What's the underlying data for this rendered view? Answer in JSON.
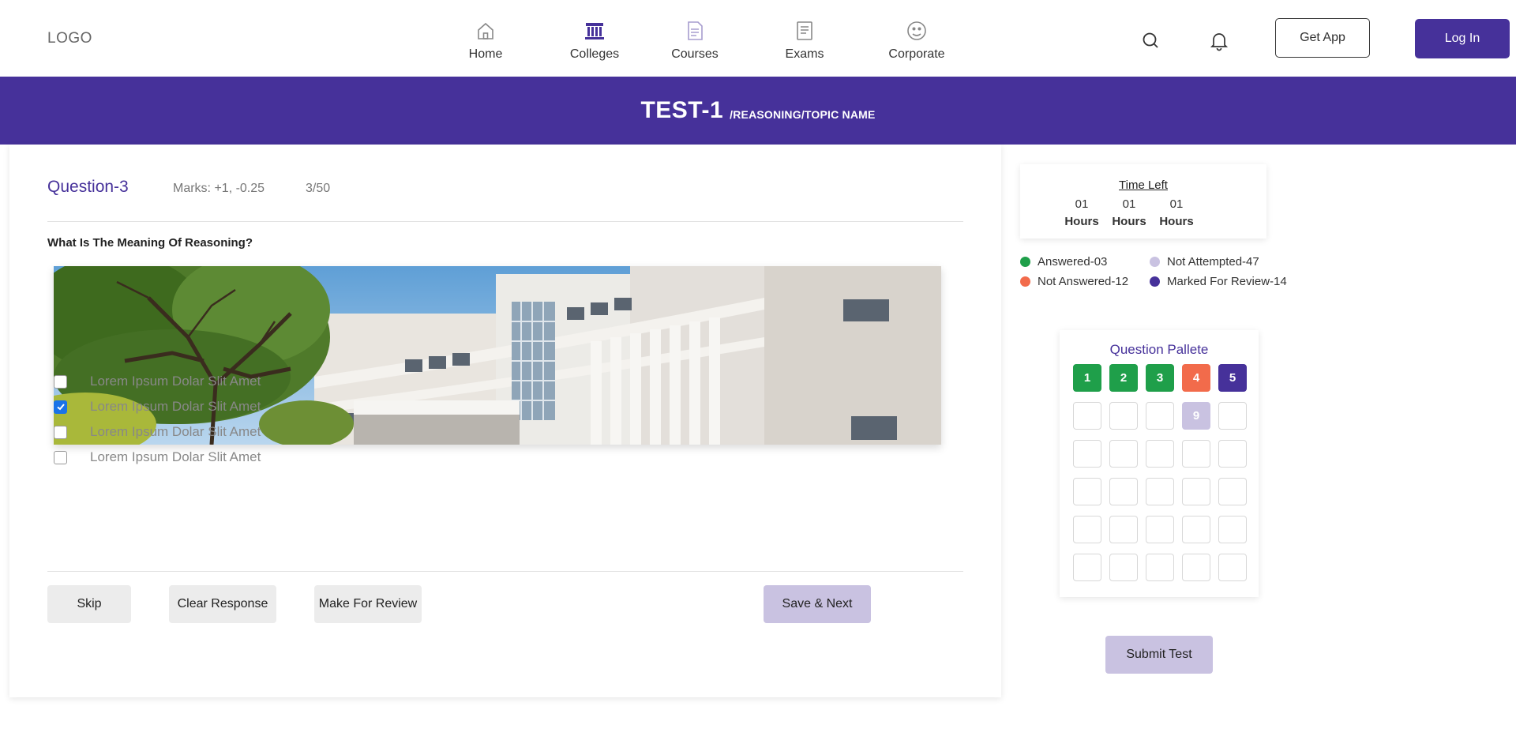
{
  "header": {
    "logo": "LOGO",
    "nav": [
      {
        "label": "Home",
        "icon": "home-icon"
      },
      {
        "label": "Colleges",
        "icon": "colleges-icon"
      },
      {
        "label": "Courses",
        "icon": "courses-icon"
      },
      {
        "label": "Exams",
        "icon": "exams-icon"
      },
      {
        "label": "Corporate",
        "icon": "corporate-icon"
      }
    ],
    "get_app": "Get App",
    "login": "Log In"
  },
  "banner": {
    "title": "TEST-1",
    "path": "/REASONING/TOPIC NAME"
  },
  "question": {
    "title": "Question-3",
    "marks": "Marks: +1, -0.25",
    "count": "3/50",
    "text": "What Is The Meaning Of Reasoning?",
    "options": [
      {
        "text": "Lorem Ipsum Dolar Slit Amet",
        "checked": false
      },
      {
        "text": "Lorem Ipsum Dolar Slit Amet",
        "checked": true
      },
      {
        "text": "Lorem Ipsum Dolar Slit Amet",
        "checked": false
      },
      {
        "text": "Lorem Ipsum Dolar Slit Amet",
        "checked": false
      }
    ],
    "actions": {
      "skip": "Skip",
      "clear": "Clear Response",
      "review": "Make For Review",
      "save": "Save & Next"
    }
  },
  "timer": {
    "label": "Time Left",
    "values": [
      {
        "num": "01",
        "unit": "Hours"
      },
      {
        "num": "01",
        "unit": "Hours"
      },
      {
        "num": "01",
        "unit": "Hours"
      }
    ]
  },
  "legend": {
    "answered": "Answered-03",
    "not_attempted": "Not Attempted-47",
    "not_answered": "Not Answered-12",
    "marked_review": "Marked For Review-14"
  },
  "palette": {
    "title": "Question Pallete",
    "cells": [
      {
        "label": "1",
        "status": "ans"
      },
      {
        "label": "2",
        "status": "ans"
      },
      {
        "label": "3",
        "status": "ans"
      },
      {
        "label": "4",
        "status": "nans"
      },
      {
        "label": "5",
        "status": "rev"
      },
      {
        "label": "",
        "status": "empty"
      },
      {
        "label": "",
        "status": "empty"
      },
      {
        "label": "",
        "status": "empty"
      },
      {
        "label": "9",
        "status": "na"
      },
      {
        "label": "",
        "status": "empty"
      },
      {
        "label": "",
        "status": "empty"
      },
      {
        "label": "",
        "status": "empty"
      },
      {
        "label": "",
        "status": "empty"
      },
      {
        "label": "",
        "status": "empty"
      },
      {
        "label": "",
        "status": "empty"
      },
      {
        "label": "",
        "status": "empty"
      },
      {
        "label": "",
        "status": "empty"
      },
      {
        "label": "",
        "status": "empty"
      },
      {
        "label": "",
        "status": "empty"
      },
      {
        "label": "",
        "status": "empty"
      },
      {
        "label": "",
        "status": "empty"
      },
      {
        "label": "",
        "status": "empty"
      },
      {
        "label": "",
        "status": "empty"
      },
      {
        "label": "",
        "status": "empty"
      },
      {
        "label": "",
        "status": "empty"
      },
      {
        "label": "",
        "status": "empty"
      },
      {
        "label": "",
        "status": "empty"
      },
      {
        "label": "",
        "status": "empty"
      },
      {
        "label": "",
        "status": "empty"
      },
      {
        "label": "",
        "status": "empty"
      }
    ]
  },
  "submit": "Submit Test",
  "colors": {
    "brand": "#46319a",
    "answered": "#1f9f4a",
    "not_answered": "#f26b4b",
    "not_attempted": "#c9c2e1",
    "marked_review": "#46319a"
  }
}
